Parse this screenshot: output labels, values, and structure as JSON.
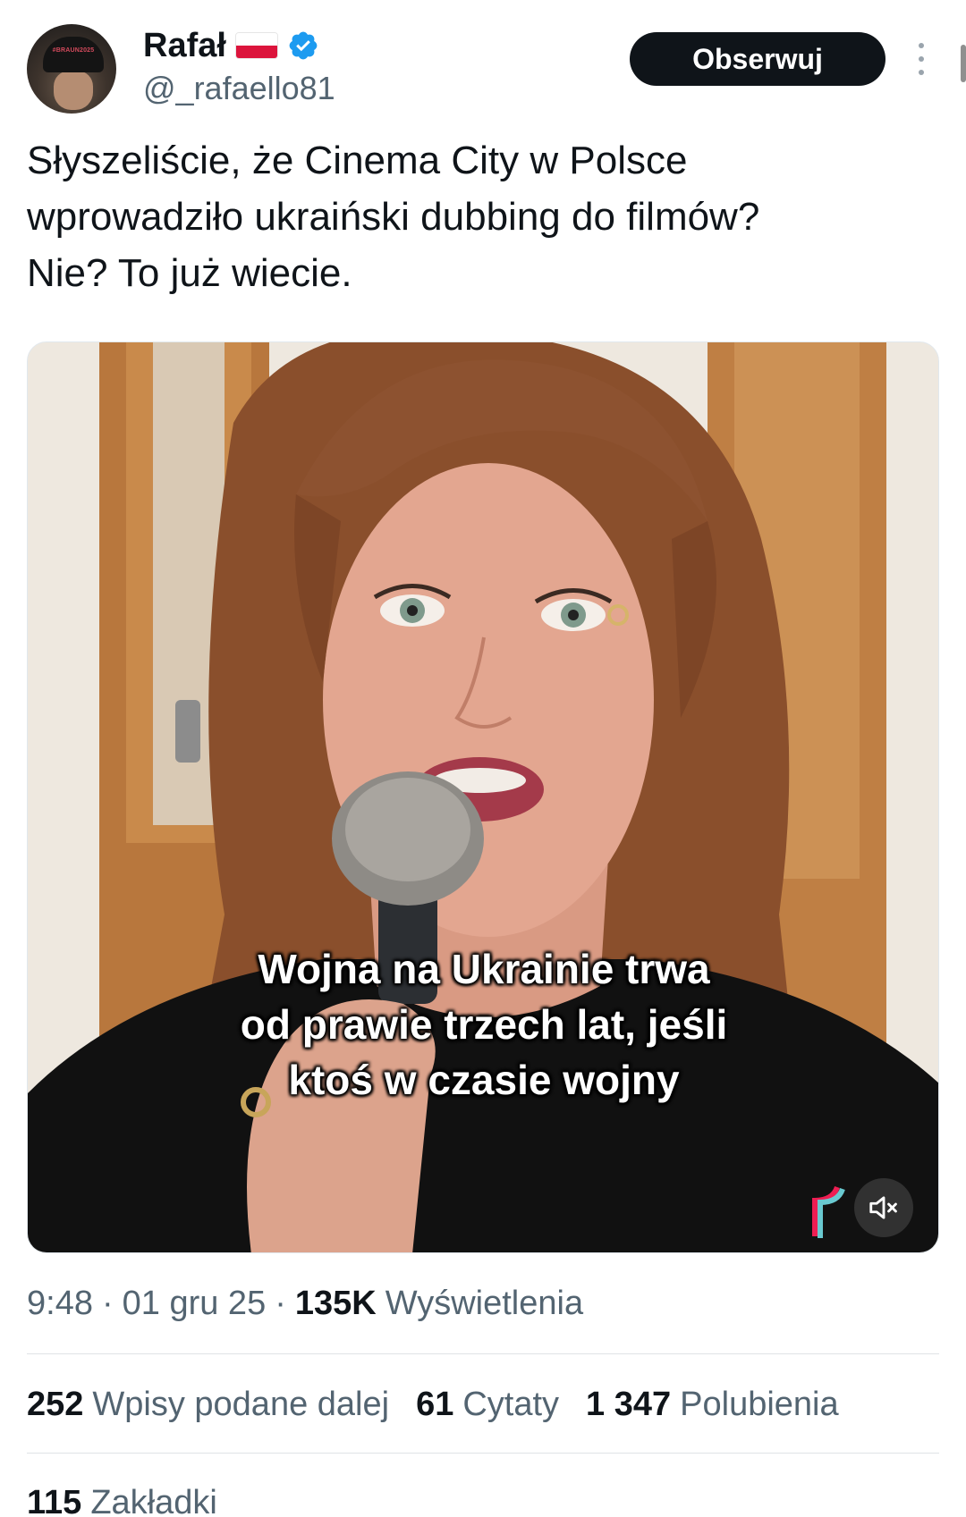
{
  "author": {
    "display_name": "Rafał",
    "handle": "@_rafaello81",
    "avatar_cap_text": "#BRAUN2025",
    "verified": true
  },
  "header": {
    "follow_label": "Obserwuj",
    "more_icon": "more-vertical-icon"
  },
  "tweet": {
    "text_lines": [
      "Słyszeliście, że Cinema City w Polsce",
      "wprowadziło ukraiński dubbing do filmów?",
      "Nie? To już wiecie."
    ]
  },
  "media": {
    "caption_lines": [
      "Wojna na Ukrainie trwa",
      "od prawie trzech lat, jeśli",
      "ktoś w czasie wojny"
    ],
    "mute_icon": "speaker-muted-icon"
  },
  "meta": {
    "time": "9:48",
    "separator": "·",
    "date": "01 gru 25",
    "views_count": "135K",
    "views_label": "Wyświetlenia"
  },
  "stats": {
    "reposts_count": "252",
    "reposts_label": "Wpisy podane dalej",
    "quotes_count": "61",
    "quotes_label": "Cytaty",
    "likes_count": "1 347",
    "likes_label": "Polubienia",
    "bookmarks_count": "115",
    "bookmarks_label": "Zakładki"
  },
  "colors": {
    "verified_blue": "#1d9bf0",
    "button_dark": "#0f1419",
    "secondary_text": "#536471"
  }
}
